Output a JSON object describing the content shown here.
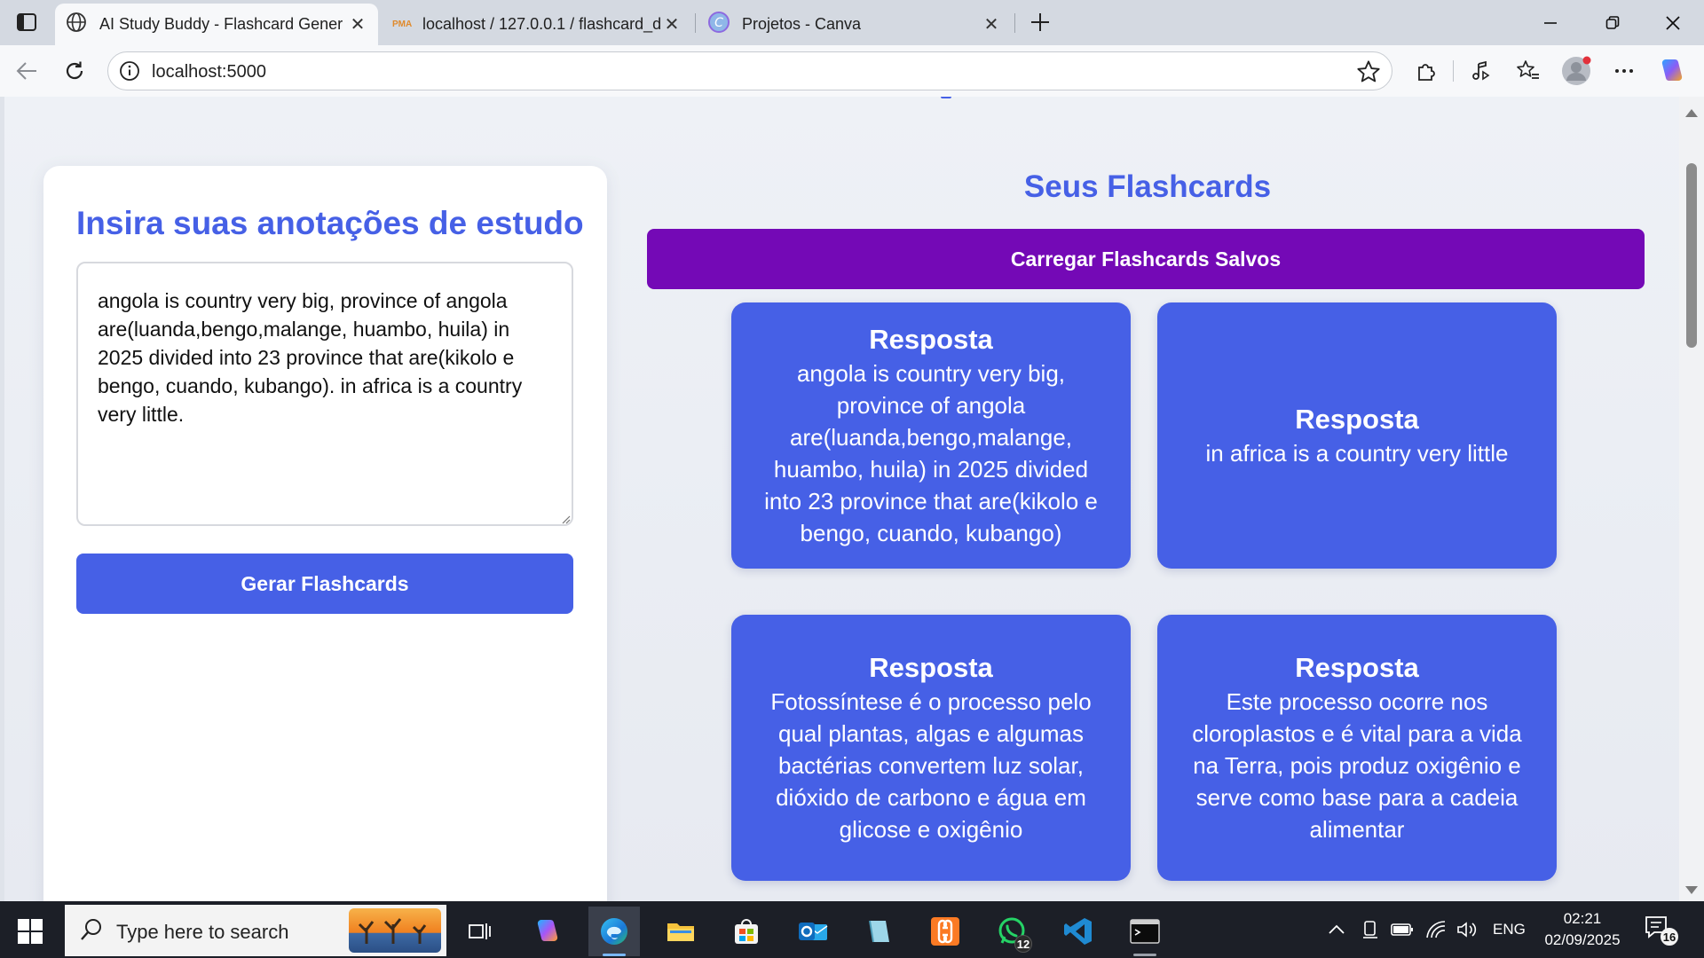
{
  "browser": {
    "tabs": [
      {
        "title": "AI Study Buddy - Flashcard Gener",
        "active": true,
        "icon": "globe-icon"
      },
      {
        "title": "localhost / 127.0.0.1 / flashcard_d",
        "active": false,
        "icon": "phpmyadmin-icon",
        "icon_text": "PMA"
      },
      {
        "title": "Projetos - Canva",
        "active": false,
        "icon": "canva-icon"
      }
    ],
    "address": "localhost:5000"
  },
  "page": {
    "input_panel": {
      "title": "Insira suas anotações de estudo",
      "notes_value": "angola is country very big, province of angola are(luanda,bengo,malange, huambo, huila) in 2025 divided into 23 province that are(kikolo e bengo, cuando, kubango). in africa is a country very little.",
      "generate_label": "Gerar Flashcards"
    },
    "flashcards": {
      "title": "Seus Flashcards",
      "load_label": "Carregar Flashcards Salvos",
      "cards": [
        {
          "head": "Resposta",
          "body": "angola is country very big, province of angola are(luanda,bengo,malange, huambo, huila) in 2025 divided into 23 province that are(kikolo e bengo, cuando, kubango)"
        },
        {
          "head": "Resposta",
          "body": "in africa is a country very little"
        },
        {
          "head": "Resposta",
          "body": "Fotossíntese é o processo pelo qual plantas, algas e algumas bactérias convertem luz solar, dióxido de carbono e água em glicose e oxigênio"
        },
        {
          "head": "Resposta",
          "body": "Este processo ocorre nos cloroplastos e é vital para a vida na Terra, pois produz oxigênio e serve como base para a cadeia alimentar"
        }
      ]
    },
    "colors": {
      "accent": "#4660e6",
      "load_button": "#7409b6"
    }
  },
  "taskbar": {
    "search_placeholder": "Type here to search",
    "whatsapp_badge": "12",
    "language": "ENG",
    "time": "02:21",
    "date": "02/09/2025",
    "notifications": "16"
  }
}
